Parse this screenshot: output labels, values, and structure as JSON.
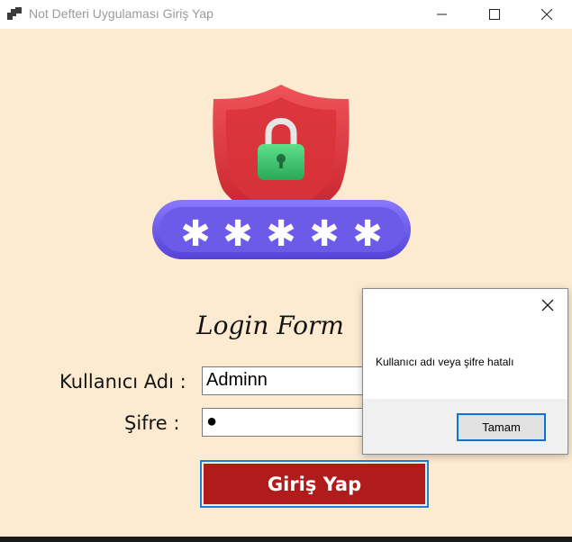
{
  "window": {
    "title": "Not Defteri Uygulaması Giriş Yap",
    "icon": "app-window-icon",
    "controls": [
      "minimize-icon",
      "maximize-icon",
      "close-icon"
    ]
  },
  "form": {
    "title": "Login Form",
    "username_label": "Kullanıcı Adı :",
    "username_value": "Adminn",
    "password_label": "Şifre :",
    "password_value": "●",
    "submit_label": "Giriş Yap",
    "hero_icons": [
      "shield-icon",
      "padlock-icon",
      "password-stars-icon"
    ]
  },
  "dialog": {
    "message": "Kullanıcı adı veya şifre hatalı",
    "ok_label": "Tamam",
    "close_icon": "close-icon"
  },
  "colors": {
    "background": "#fdebd1",
    "accent_red": "#b01c1c",
    "shield_red": "#e03a3e",
    "pill_purple": "#6b57e8",
    "lock_green": "#3ec46b",
    "focus_blue": "#1f7fd8"
  }
}
